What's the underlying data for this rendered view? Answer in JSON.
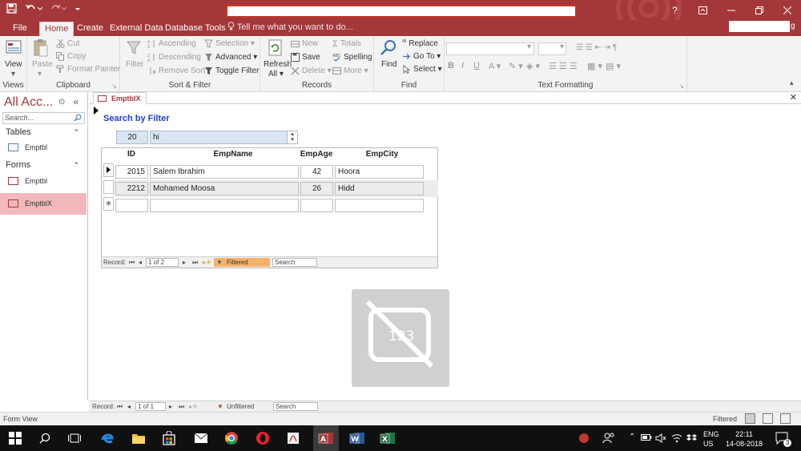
{
  "ribbon_tabs": [
    "File",
    "Home",
    "Create",
    "External Data",
    "Database Tools"
  ],
  "tell_me": "Tell me what you want to do...",
  "signin_suffix": "g",
  "groups": {
    "views": {
      "label": "Views",
      "view": "View"
    },
    "clipboard": {
      "label": "Clipboard",
      "paste": "Paste",
      "cut": "Cut",
      "copy": "Copy",
      "format_painter": "Format Painter"
    },
    "sort_filter": {
      "label": "Sort & Filter",
      "filter": "Filter",
      "ascending": "Ascending",
      "descending": "Descending",
      "remove_sort": "Remove Sort",
      "selection": "Selection",
      "advanced": "Advanced",
      "toggle_filter": "Toggle Filter"
    },
    "records": {
      "label": "Records",
      "refresh": "Refresh",
      "refresh_all": "All",
      "new": "New",
      "save": "Save",
      "delete": "Delete",
      "totals": "Totals",
      "spelling": "Spelling",
      "more": "More"
    },
    "find": {
      "label": "Find",
      "find": "Find",
      "replace": "Replace",
      "go_to": "Go To",
      "select": "Select"
    },
    "text_formatting": {
      "label": "Text Formatting",
      "bold": "B",
      "italic": "I",
      "underline": "U"
    }
  },
  "nav": {
    "title": "All Acc...",
    "search_placeholder": "Search...",
    "sections": [
      {
        "label": "Tables",
        "items": [
          "Emptbl"
        ]
      },
      {
        "label": "Forms",
        "items": [
          "Emptbl",
          "EmptblX"
        ]
      }
    ]
  },
  "document": {
    "tab_label": "EmptblX",
    "heading": "Search by Filter",
    "filter_id": "20",
    "filter_text": "hi",
    "columns": [
      "ID",
      "EmpName",
      "EmpAge",
      "EmpCity"
    ],
    "rows": [
      {
        "id": "2015",
        "name": "Salem Ibrahim",
        "age": "42",
        "city": "Hoora"
      },
      {
        "id": "2212",
        "name": "Mohamed Moosa",
        "age": "26",
        "city": "Hidd"
      }
    ],
    "new_row_marker": "✳",
    "subform_nav": {
      "record_label": "Record:",
      "position": "1 of 2",
      "filter_state": "Filtered",
      "search": "Search"
    },
    "main_nav": {
      "record_label": "Record:",
      "position": "1 of 1",
      "filter_state": "Unfiltered",
      "search": "Search"
    }
  },
  "status": {
    "left": "Form View",
    "right": "Filtered"
  },
  "taskbar": {
    "lang": "ENG",
    "region": "US",
    "time": "22:11",
    "date": "14-08-2018",
    "notif_count": "3"
  }
}
